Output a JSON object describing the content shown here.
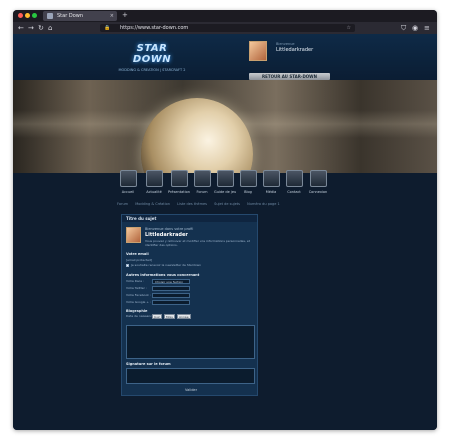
{
  "browser": {
    "tab_title": "Star Down",
    "close_glyph": "×",
    "newtab_glyph": "+",
    "url": "https://www.star-down.com",
    "lock_glyph": "🔒"
  },
  "header": {
    "logo_text": "STAR DOWN",
    "logo_sub": "MODDING & CREATION | STARCRAFT 2",
    "pseudo_label": "Bienvenue",
    "pseudo": "Littledarkrader",
    "go_button": "RETOUR AU STAR-DOWN"
  },
  "menu": [
    {
      "label": "Accueil"
    },
    {
      "label": "Actualité"
    },
    {
      "label": "Présentation"
    },
    {
      "label": "Forum"
    },
    {
      "label": "Guide de jeu"
    },
    {
      "label": "Blog"
    },
    {
      "label": "Média"
    },
    {
      "label": "Contact"
    },
    {
      "label": "Connexion"
    }
  ],
  "breadcrumbs": [
    "Forum",
    "Modding & Création",
    "Liste des thèmes",
    "Sujet de sujets",
    "Numéro du page 1"
  ],
  "panel": {
    "title": "Titre du sujet",
    "welcome": "Bienvenue dans votre profil",
    "username": "Littledarkrader",
    "description": "Vous pouvez y retrouver et modifier vos informations personnelles, et identifier des options.",
    "email_heading": "Votre email",
    "email_value": "[email protected]",
    "newsletter": "Je souhaite recevoir la newsletter de Stardown",
    "other_heading": "Autres informations vous concernant",
    "fields": [
      {
        "label": "Votre Race :",
        "value": "Choisir une faction"
      },
      {
        "label": "Votre Twitter :",
        "value": ""
      },
      {
        "label": "Votre Facebook :",
        "value": ""
      },
      {
        "label": "Votre Google + :",
        "value": ""
      }
    ],
    "bio_heading": "Biographie",
    "birth_label": "Date de naissance :",
    "birth_day": "Jour",
    "birth_month": "Mois",
    "birth_year": "Année",
    "signature_heading": "Signature sur le forum",
    "save_label": "Valider"
  }
}
